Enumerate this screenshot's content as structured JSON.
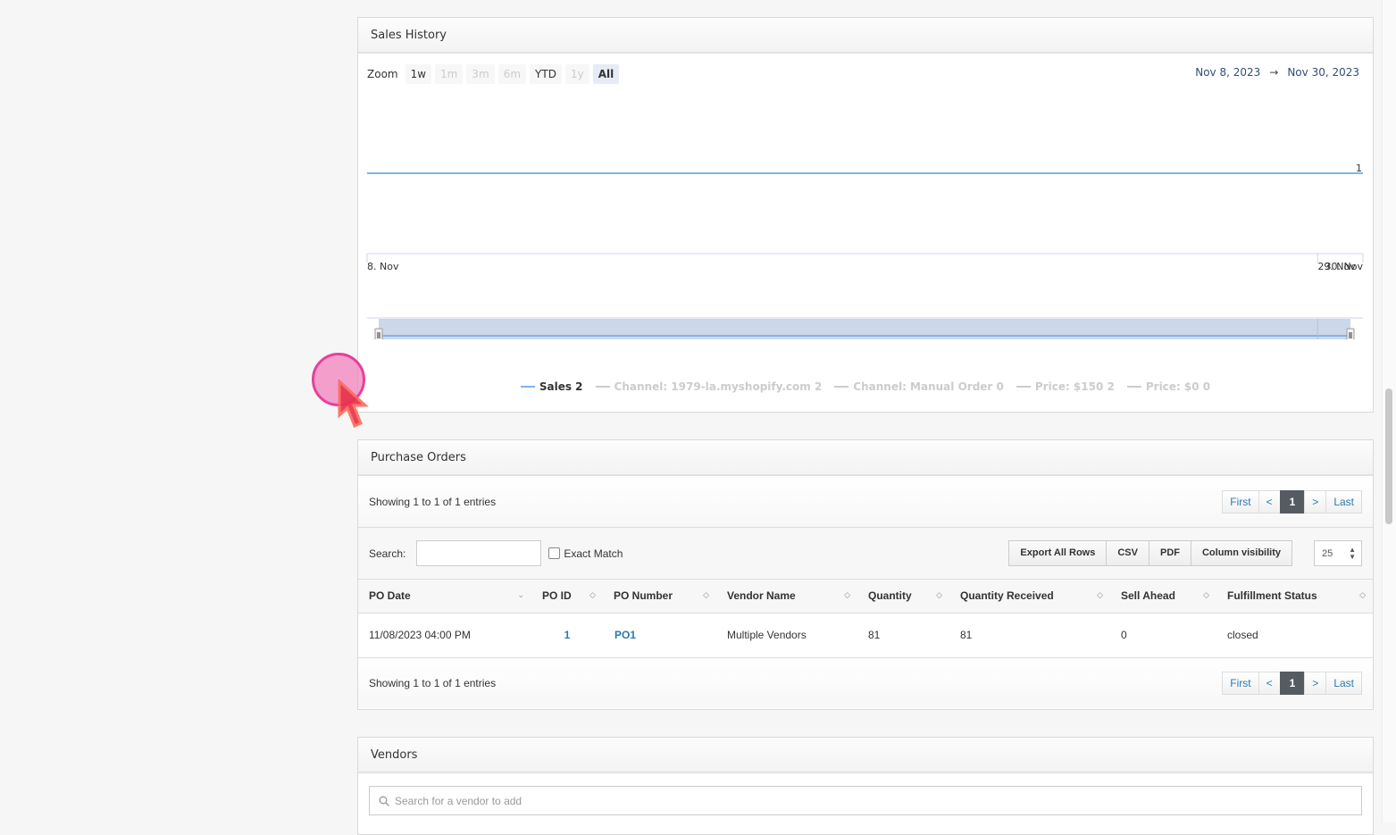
{
  "sales_history": {
    "title": "Sales History",
    "zoom_label": "Zoom",
    "zoom_buttons": [
      {
        "label": "1w",
        "state": "enabled"
      },
      {
        "label": "1m",
        "state": "disabled"
      },
      {
        "label": "3m",
        "state": "disabled"
      },
      {
        "label": "6m",
        "state": "disabled"
      },
      {
        "label": "YTD",
        "state": "enabled"
      },
      {
        "label": "1y",
        "state": "disabled"
      },
      {
        "label": "All",
        "state": "active"
      }
    ],
    "range_from": "Nov 8, 2023",
    "range_arrow": "→",
    "range_to": "Nov 30, 2023",
    "legend": [
      {
        "label": "Sales 2",
        "visible": true
      },
      {
        "label": "Channel: 1979-la.myshopify.com 2",
        "visible": false
      },
      {
        "label": "Channel: Manual Order 0",
        "visible": false
      },
      {
        "label": "Price: $150 2",
        "visible": false
      },
      {
        "label": "Price: $0 0",
        "visible": false
      }
    ],
    "series_color": "#7cb5ec"
  },
  "chart_data": {
    "type": "line",
    "title": "",
    "x": [
      "8. Nov",
      "29. Nov",
      "30. Nov"
    ],
    "x_days": [
      8,
      29,
      30
    ],
    "series": [
      {
        "name": "Sales",
        "values": [
          1,
          1,
          1
        ]
      }
    ],
    "end_label": "1",
    "xlabel": "",
    "ylabel": "",
    "navigator_ticks": [
      "8. Nov",
      "29. Nov"
    ],
    "grid": false,
    "legend_position": "bottom"
  },
  "purchase_orders": {
    "title": "Purchase Orders",
    "info": "Showing 1 to 1 of 1 entries",
    "pager": {
      "first": "First",
      "prev": "<",
      "current": "1",
      "next": ">",
      "last": "Last"
    },
    "search_label": "Search:",
    "search_value": "",
    "exact_match_label": "Exact Match",
    "buttons": [
      "Export All Rows",
      "CSV",
      "PDF",
      "Column visibility"
    ],
    "page_length": "25",
    "columns": [
      "PO Date",
      "PO ID",
      "PO Number",
      "Vendor Name",
      "Quantity",
      "Quantity Received",
      "Sell Ahead",
      "Fulfillment Status"
    ],
    "rows": [
      {
        "po_date": "11/08/2023 04:00 PM",
        "po_id": "1",
        "po_number": "PO1",
        "vendor": "Multiple Vendors",
        "quantity": "81",
        "received": "81",
        "sell_ahead": "0",
        "status": "closed"
      }
    ]
  },
  "vendors": {
    "title": "Vendors",
    "search_placeholder": "Search for a vendor to add"
  }
}
